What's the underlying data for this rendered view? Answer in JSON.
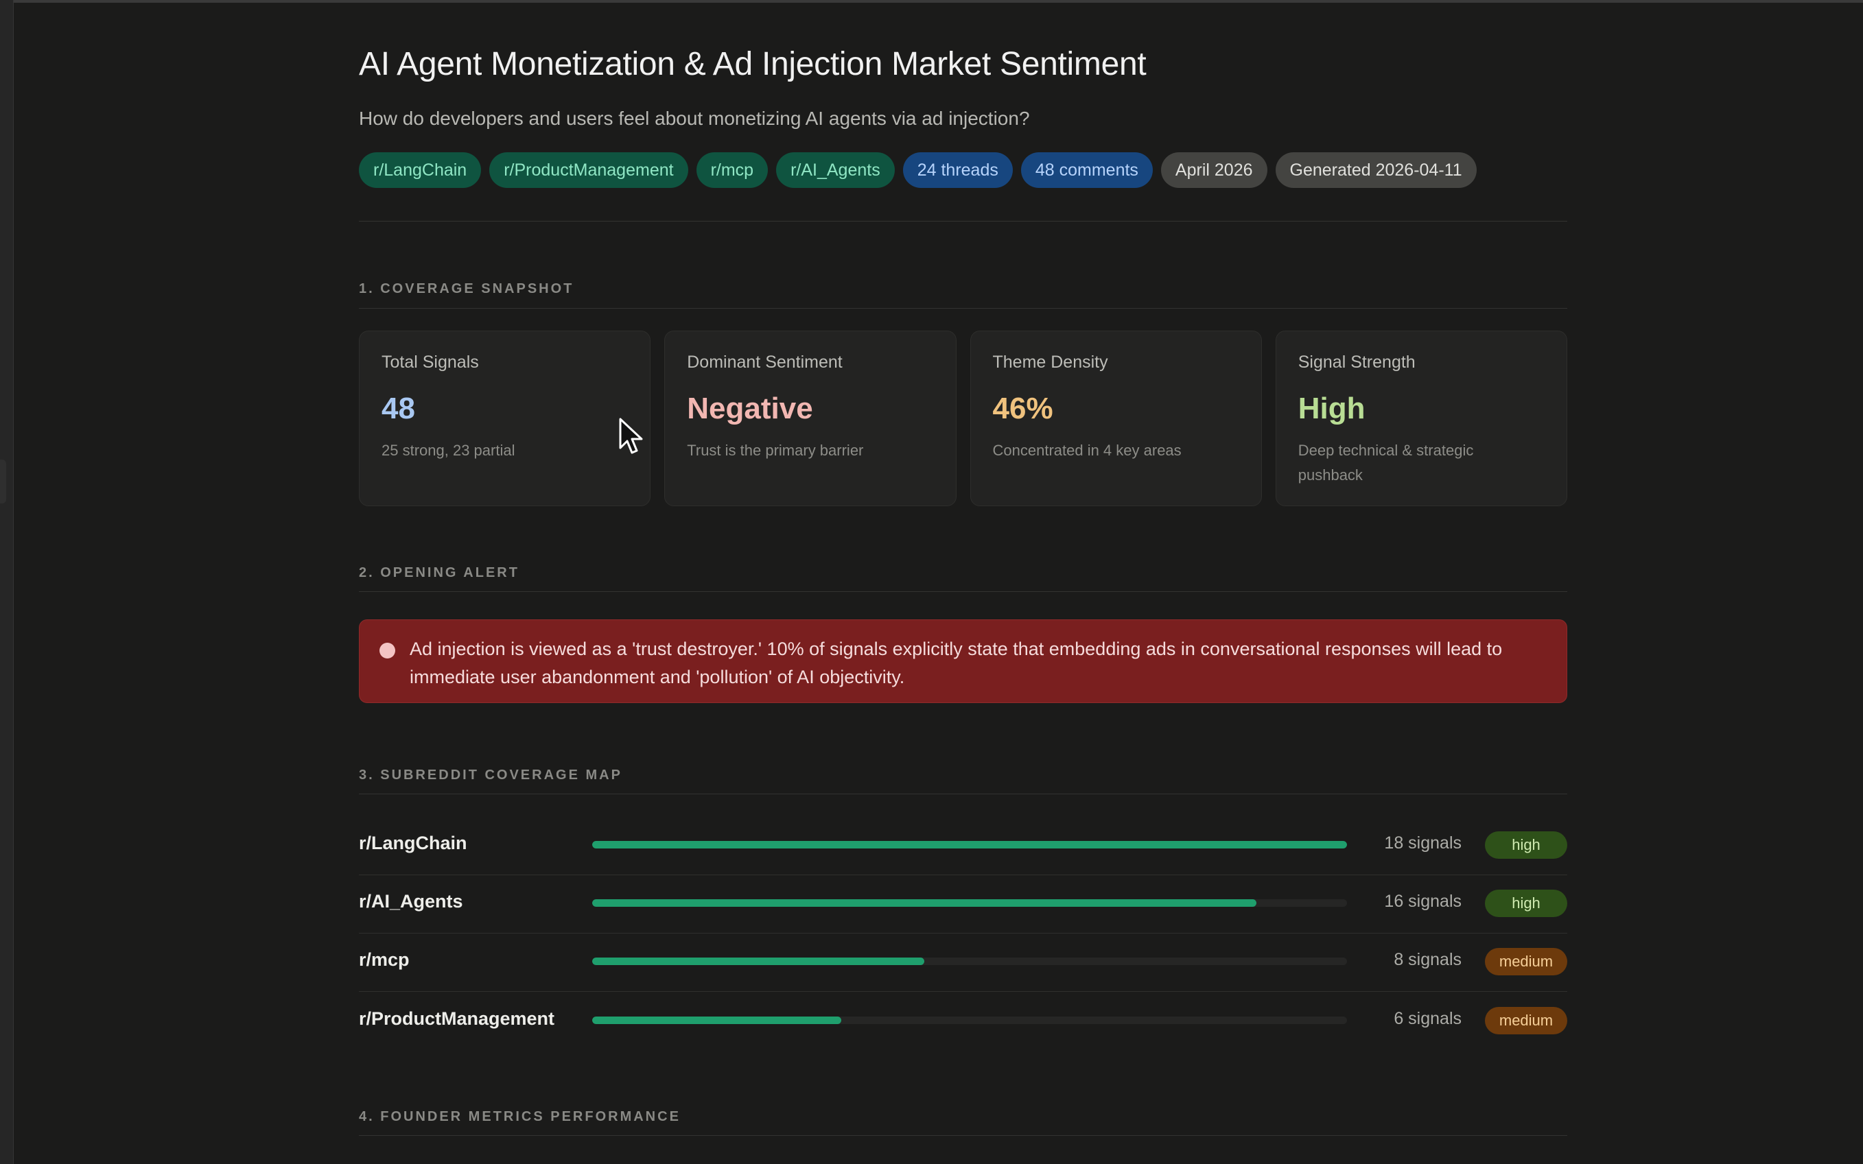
{
  "header": {
    "title": "AI Agent Monetization & Ad Injection Market Sentiment",
    "subtitle": "How do developers and users feel about monetizing AI agents via ad injection?",
    "tags": [
      {
        "label": "r/LangChain",
        "style": "green"
      },
      {
        "label": "r/ProductManagement",
        "style": "green"
      },
      {
        "label": "r/mcp",
        "style": "green"
      },
      {
        "label": "r/AI_Agents",
        "style": "green"
      },
      {
        "label": "24 threads",
        "style": "blue"
      },
      {
        "label": "48 comments",
        "style": "blue"
      },
      {
        "label": "April 2026",
        "style": "gray"
      },
      {
        "label": "Generated 2026-04-11",
        "style": "gray"
      }
    ]
  },
  "sections": {
    "coverage_snapshot": "1. COVERAGE SNAPSHOT",
    "opening_alert": "2. OPENING ALERT",
    "subreddit_coverage_map": "3. SUBREDDIT COVERAGE MAP",
    "founder_metrics": "4. FOUNDER METRICS PERFORMANCE"
  },
  "cards": [
    {
      "label": "Total Signals",
      "value": "48",
      "sub": "25 strong, 23 partial",
      "color": "#a9c8f2"
    },
    {
      "label": "Dominant Sentiment",
      "value": "Negative",
      "sub": "Trust is the primary barrier",
      "color": "#f2b7b2"
    },
    {
      "label": "Theme Density",
      "value": "46%",
      "sub": "Concentrated in 4 key areas",
      "color": "#f0c27e"
    },
    {
      "label": "Signal Strength",
      "value": "High",
      "sub": "Deep technical & strategic pushback",
      "color": "#b8dd94"
    }
  ],
  "alert": {
    "text": "Ad injection is viewed as a 'trust destroyer.' 10% of signals explicitly state that embedding ads in conversational responses will lead to immediate user abandonment and 'pollution' of AI objectivity.",
    "color": "#7a1f1f"
  },
  "coverage": [
    {
      "name": "r/LangChain",
      "signals": 18,
      "count_label": "18 signals",
      "level": "high",
      "fill": 1.0
    },
    {
      "name": "r/AI_Agents",
      "signals": 16,
      "count_label": "16 signals",
      "level": "high",
      "fill": 0.88
    },
    {
      "name": "r/mcp",
      "signals": 8,
      "count_label": "8 signals",
      "level": "medium",
      "fill": 0.44
    },
    {
      "name": "r/ProductManagement",
      "signals": 6,
      "count_label": "6 signals",
      "level": "medium",
      "fill": 0.33
    }
  ],
  "colors": {
    "background": "#1b1b1a",
    "bar_fill": "#1f9f6d",
    "high_badge": "#2e5119",
    "medium_badge": "#6d3a0c"
  }
}
